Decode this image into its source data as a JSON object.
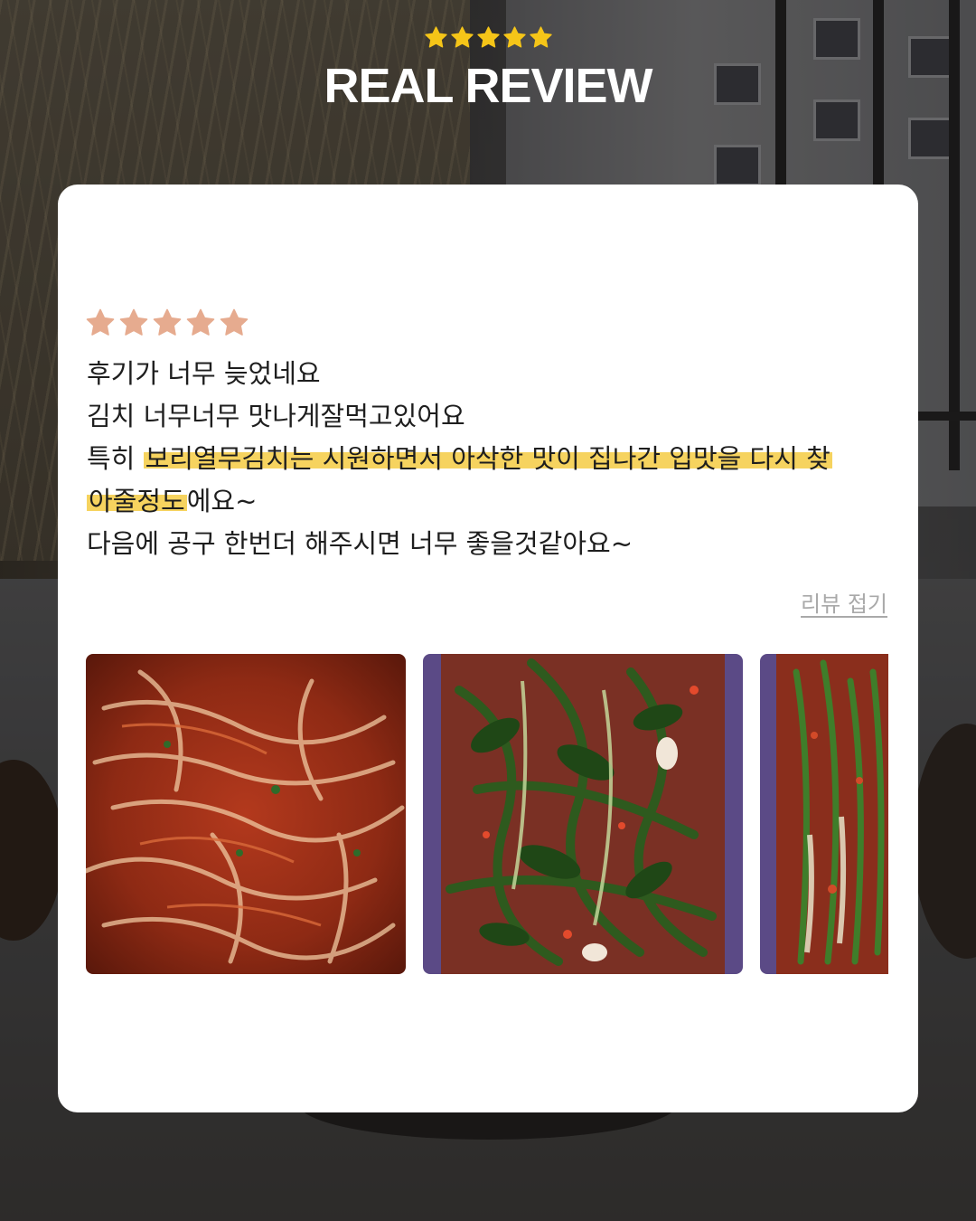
{
  "header": {
    "stars": 5,
    "star_color": "#f5c518",
    "title": "REAL REVIEW"
  },
  "review": {
    "rating": 5,
    "star_color": "#e6ab8f",
    "lines": [
      {
        "plain": "후기가 너무 늦었네요"
      },
      {
        "plain": "김치 너무너무 맛나게잘먹고있어요"
      },
      {
        "prefix": "특히 ",
        "highlight": "보리열무김치는 시원하면서 아삭한 맛이 집나간 입맛을 다시 찾"
      },
      {
        "highlight": "아줄정도",
        "suffix": "에요~"
      },
      {
        "plain": "다음에 공구 한번더 해주시면 너무 좋을것같아요~"
      }
    ],
    "highlight_color": "#f6d35f",
    "fold_label": "리뷰 접기"
  },
  "gallery": {
    "photos": [
      {
        "name": "cabbage-kimchi-photo"
      },
      {
        "name": "young-radish-kimchi-photo"
      },
      {
        "name": "green-onion-kimchi-photo"
      }
    ]
  }
}
